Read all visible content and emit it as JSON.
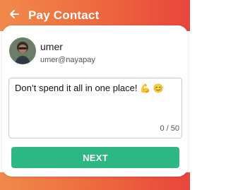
{
  "header": {
    "title": "Pay Contact",
    "back_icon": "arrow-left-icon"
  },
  "contact": {
    "name": "umer",
    "handle": "umer@nayapay",
    "avatar_icon": "user-avatar"
  },
  "message": {
    "text": "Don’t spend it all in one place!",
    "emoji_1": "💪",
    "emoji_2": "😊",
    "counter": "0 / 50"
  },
  "actions": {
    "next_label": "NEXT"
  },
  "colors": {
    "header_gradient_start": "#f08a4b",
    "header_gradient_end": "#e8453c",
    "next_button": "#2db784"
  }
}
